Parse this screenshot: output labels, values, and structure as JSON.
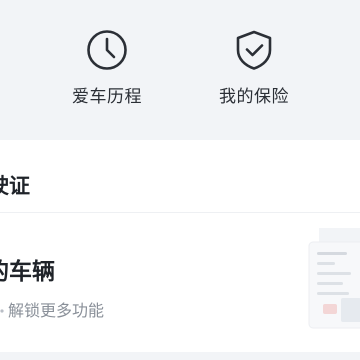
{
  "quick_entries": [
    {
      "label": "爱车历程",
      "icon": "clock-icon"
    },
    {
      "label": "我的保险",
      "icon": "shield-check-icon"
    }
  ],
  "section": {
    "title": "驶证"
  },
  "vehicle_card": {
    "title": "的车辆",
    "subtitle": "解锁更多功能",
    "illustration": "driving-license-illustration"
  },
  "colors": {
    "background": "#f2f4f7",
    "card": "#ffffff",
    "text_primary": "#1f2329",
    "text_secondary": "#8a9099",
    "icon_stroke": "#2b2f36"
  }
}
